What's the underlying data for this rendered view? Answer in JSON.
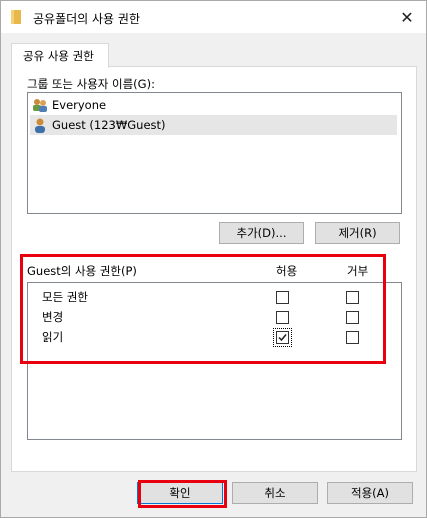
{
  "window": {
    "title": "공유폴더의 사용 권한"
  },
  "tab": {
    "label": "공유 사용 권한"
  },
  "groups": {
    "label": "그룹 또는 사용자 이름(G):",
    "users": [
      {
        "name": "Everyone",
        "icon": "group-users-icon",
        "selected": false
      },
      {
        "name": "Guest (123₩Guest)",
        "icon": "user-icon",
        "selected": true
      }
    ],
    "add_button": "추가(D)...",
    "remove_button": "제거(R)"
  },
  "permissions": {
    "title": "Guest의 사용 권한(P)",
    "allow_header": "허용",
    "deny_header": "거부",
    "rows": [
      {
        "name": "모든 권한",
        "allow": false,
        "deny": false
      },
      {
        "name": "변경",
        "allow": false,
        "deny": false
      },
      {
        "name": "읽기",
        "allow": true,
        "deny": false
      }
    ]
  },
  "footer": {
    "ok": "확인",
    "cancel": "취소",
    "apply": "적용(A)"
  },
  "colors": {
    "highlight": "#e8000e",
    "accent": "#0078d7"
  }
}
